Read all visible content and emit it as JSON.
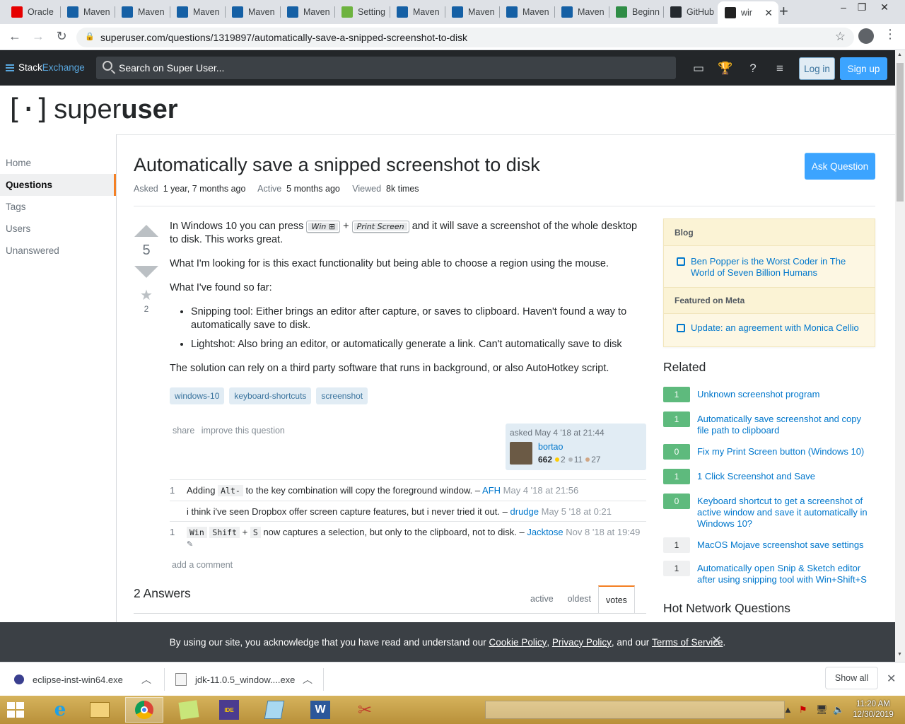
{
  "browser": {
    "tabs": [
      {
        "label": "Oracle",
        "icon": "oracle-icon",
        "color": "#e60000"
      },
      {
        "label": "Maven",
        "icon": "maven-icon",
        "color": "#1560a5"
      },
      {
        "label": "Maven",
        "icon": "maven-icon",
        "color": "#1560a5"
      },
      {
        "label": "Maven",
        "icon": "maven-icon",
        "color": "#1560a5"
      },
      {
        "label": "Maven",
        "icon": "maven-icon",
        "color": "#1560a5"
      },
      {
        "label": "Maven",
        "icon": "maven-icon",
        "color": "#1560a5"
      },
      {
        "label": "Setting",
        "icon": "spring-icon",
        "color": "#6db33f"
      },
      {
        "label": "Maven",
        "icon": "maven-icon",
        "color": "#1560a5"
      },
      {
        "label": "Maven",
        "icon": "maven-icon",
        "color": "#1560a5"
      },
      {
        "label": "Maven",
        "icon": "dot-icon",
        "color": "#1560a5"
      },
      {
        "label": "Maven",
        "icon": "maven-icon",
        "color": "#1560a5"
      },
      {
        "label": "Beginn",
        "icon": "gfg-icon",
        "color": "#2f8d46"
      },
      {
        "label": "GitHub",
        "icon": "github-icon",
        "color": "#24292e"
      },
      {
        "label": "wir",
        "icon": "superuser-icon",
        "color": "#222"
      }
    ],
    "url": "superuser.com/questions/1319897/automatically-save-a-snipped-screenshot-to-disk",
    "new_tab": "+",
    "close": "✕"
  },
  "se": {
    "brand_a": "Stack",
    "brand_b": "Exchange",
    "search_placeholder": "Search on Super User...",
    "login": "Log in",
    "signup": "Sign up"
  },
  "site": {
    "logo_a": "super",
    "logo_b": "user"
  },
  "nav": {
    "items": [
      "Home",
      "Questions",
      "Tags",
      "Users",
      "Unanswered"
    ],
    "selected": "Questions"
  },
  "question": {
    "title": "Automatically save a snipped screenshot to disk",
    "ask_button": "Ask Question",
    "asked_label": "Asked",
    "asked_value": "1 year, 7 months ago",
    "active_label": "Active",
    "active_value": "5 months ago",
    "viewed_label": "Viewed",
    "viewed_value": "8k times",
    "votes": "5",
    "favorites": "2",
    "p1_a": "In Windows 10 you can press",
    "kbd1": "Win ⊞",
    "plus": "+",
    "kbd2": "Print Screen",
    "p1_b": "and it will save a screenshot of the whole desktop to disk. This works great.",
    "p2": "What I'm looking for is this exact functionality but being able to choose a region using the mouse.",
    "p3": "What I've found so far:",
    "li1": "Snipping tool: Either brings an editor after capture, or saves to clipboard. Haven't found a way to automatically save to disk.",
    "li2": "Lightshot: Also bring an editor, or automatically generate a link. Can't automatically save to disk",
    "p4": "The solution can rely on a third party software that runs in background, or also AutoHotkey script.",
    "tags": [
      "windows-10",
      "keyboard-shortcuts",
      "screenshot"
    ],
    "share": "share",
    "improve": "improve this question",
    "owner_asked": "asked May 4 '18 at 21:44",
    "owner_name": "bortao",
    "owner_rep": "662",
    "gold": "2",
    "silver": "11",
    "bronze": "27"
  },
  "comments": [
    {
      "score": "1",
      "a": "Adding",
      "code1": "Alt-",
      "b": "to the key combination will copy the foreground window. –",
      "user": "AFH",
      "date": "May 4 '18 at 21:56"
    },
    {
      "score": "",
      "a": "i think i've seen Dropbox offer screen capture features, but i never tried it out. –",
      "user": "drudge",
      "date": "May 5 '18 at 0:21"
    },
    {
      "score": "1",
      "code1": "Win",
      "code2": "Shift",
      "plus": "+",
      "code3": "S",
      "b": "now captures a selection, but only to the clipboard, not to disk. –",
      "user": "Jacktose",
      "date": "Nov 8 '18 at 19:49"
    }
  ],
  "add_comment": "add a comment",
  "answers": {
    "header": "2 Answers",
    "tabs": [
      "active",
      "oldest",
      "votes"
    ],
    "selected": "votes"
  },
  "sidebar": {
    "blog_header": "Blog",
    "blog_item": "Ben Popper is the Worst Coder in The World of Seven Billion Humans",
    "meta_header": "Featured on Meta",
    "meta_item": "Update: an agreement with Monica Cellio",
    "related_header": "Related",
    "related": [
      {
        "score": "1",
        "answered": true,
        "title": "Unknown screenshot program"
      },
      {
        "score": "1",
        "answered": true,
        "title": "Automatically save screenshot and copy file path to clipboard"
      },
      {
        "score": "0",
        "answered": true,
        "title": "Fix my Print Screen button (Windows 10)"
      },
      {
        "score": "1",
        "answered": true,
        "title": "1 Click Screenshot and Save"
      },
      {
        "score": "0",
        "answered": true,
        "title": "Keyboard shortcut to get a screenshot of active window and save it automatically in Windows 10?"
      },
      {
        "score": "1",
        "answered": false,
        "title": "MacOS Mojave screenshot save settings"
      },
      {
        "score": "1",
        "answered": false,
        "title": "Automatically open Snip & Sketch editor after using snipping tool with Win+Shift+S"
      }
    ],
    "hnq": "Hot Network Questions"
  },
  "cookie": {
    "a": "By using our site, you acknowledge that you have read and understand our",
    "cookie_policy": "Cookie Policy",
    "comma": ",",
    "privacy": "Privacy Policy",
    "and": ", and our",
    "tos": "Terms of Service",
    "end": "."
  },
  "downloads": {
    "items": [
      "eclipse-inst-win64.exe",
      "jdk-11.0.5_window....exe"
    ],
    "show_all": "Show all"
  },
  "taskbar": {
    "time": "11:20 AM",
    "date": "12/30/2019"
  }
}
